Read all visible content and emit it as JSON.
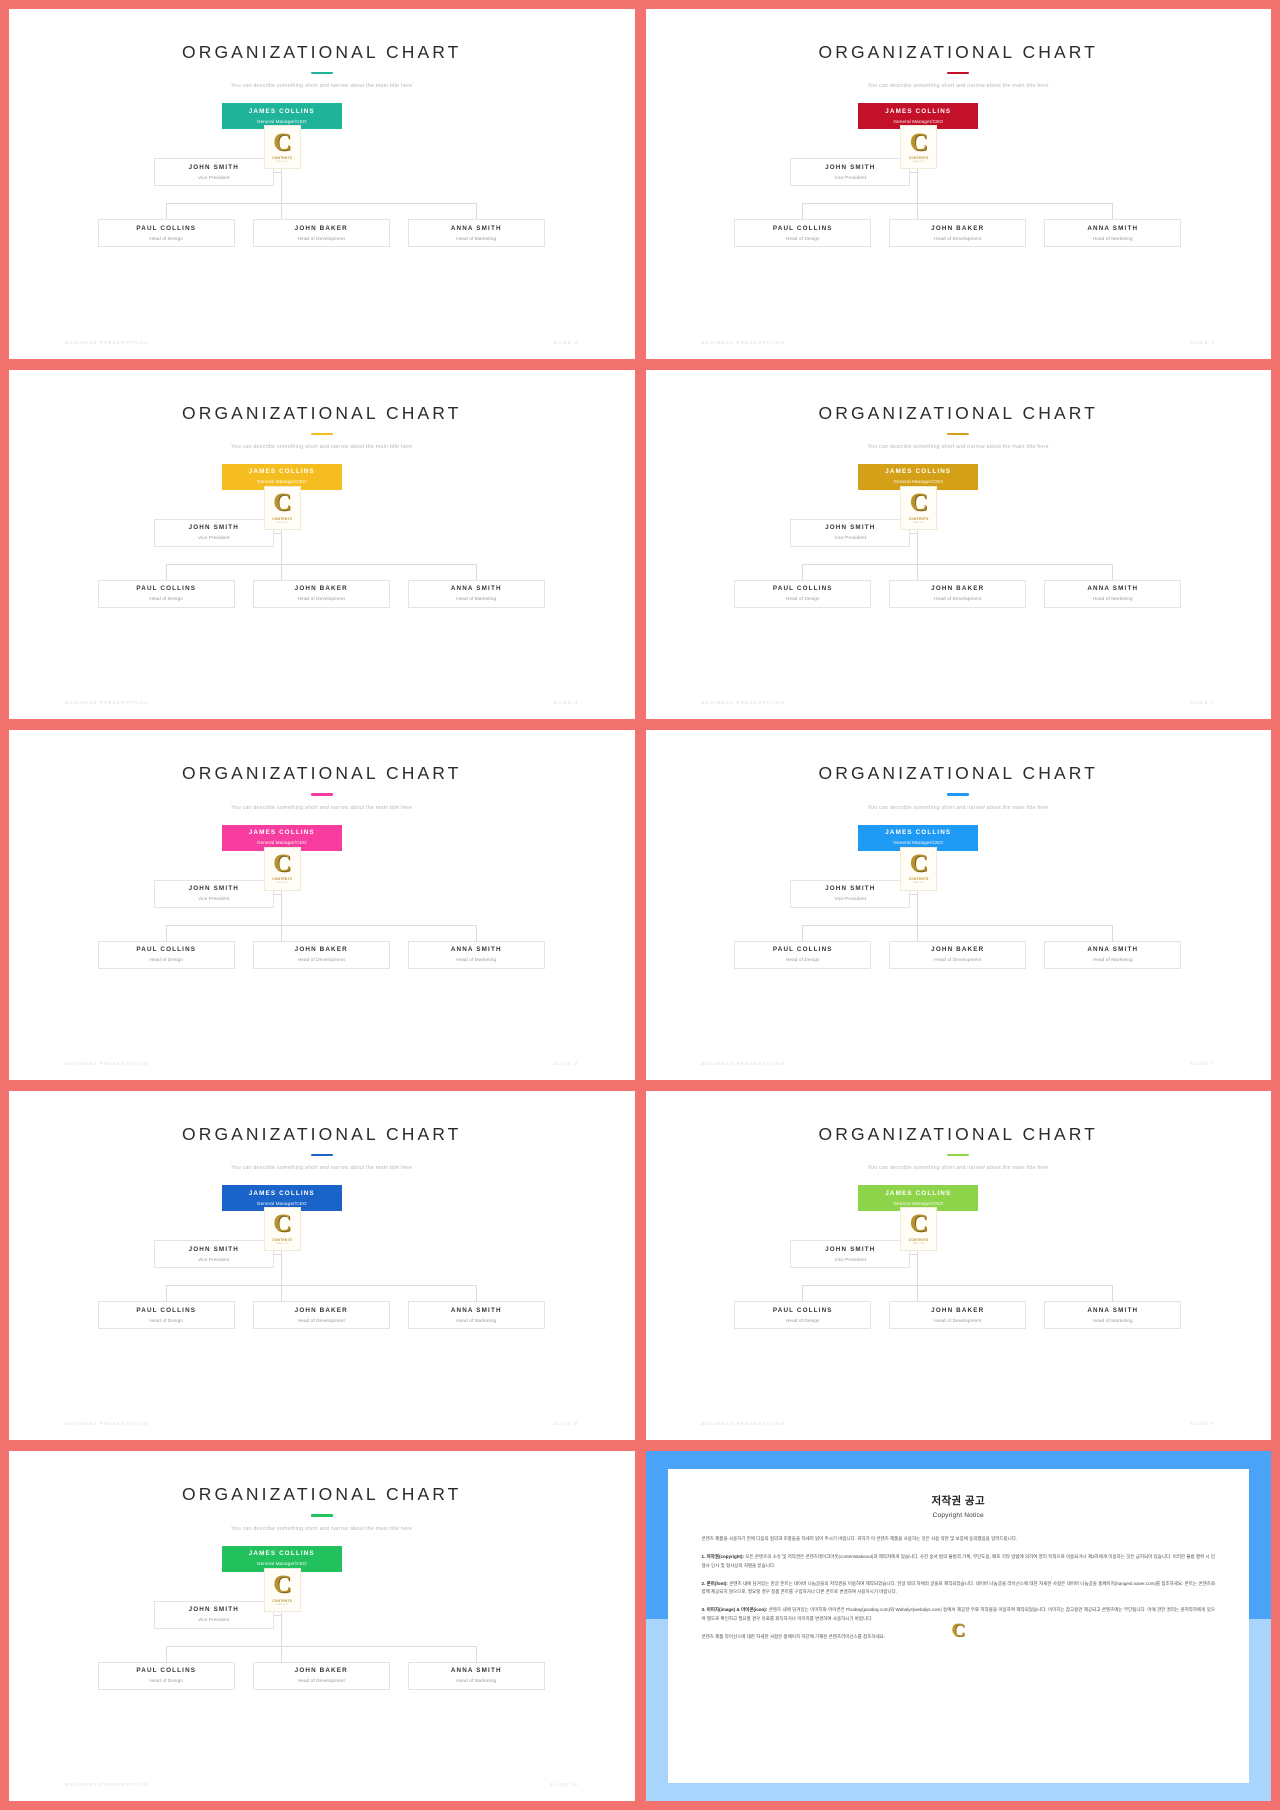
{
  "deck": {
    "title": "ORGANIZATIONAL CHART",
    "subtitle": "You can describe something short and narrow about the main title here",
    "footer_left": "BUSINESS PRESENTATION",
    "watermark": {
      "letter": "C",
      "line1": "CONTENTS",
      "line2": "TAKE OUT"
    },
    "frame_color": "#f2726f"
  },
  "org": {
    "ceo": {
      "name": "JAMES COLLINS",
      "role": "General Manager/CEO"
    },
    "vp": {
      "name": "JOHN SMITH",
      "role": "Vice President"
    },
    "level3": [
      {
        "name": "PAUL COLLINS",
        "role": "Head of Design"
      },
      {
        "name": "JOHN BAKER",
        "role": "Head of Development"
      },
      {
        "name": "ANNA SMITH",
        "role": "Head of Marketing"
      }
    ]
  },
  "slides": [
    {
      "accent": "#1fb39a",
      "ceo_bg": "#1fb39a",
      "slide_label": "SLIDE 2"
    },
    {
      "accent": "#c4112a",
      "ceo_bg": "#c4112a",
      "slide_label": "SLIDE 3"
    },
    {
      "accent": "#f5bd1f",
      "ceo_bg": "#f5bd1f",
      "slide_label": "SLIDE 4"
    },
    {
      "accent": "#d4a017",
      "ceo_bg": "#d4a017",
      "slide_label": "SLIDE 5"
    },
    {
      "accent": "#f73ea0",
      "ceo_bg": "#f73ea0",
      "slide_label": "SLIDE 6"
    },
    {
      "accent": "#1f9bf5",
      "ceo_bg": "#1f9bf5",
      "slide_label": "SLIDE 7"
    },
    {
      "accent": "#1a63c9",
      "ceo_bg": "#1a63c9",
      "slide_label": "SLIDE 8"
    },
    {
      "accent": "#8ed44a",
      "ceo_bg": "#8ed44a",
      "slide_label": "SLIDE 9"
    },
    {
      "accent": "#23c15e",
      "ceo_bg": "#23c15e",
      "slide_label": "SLIDE 10"
    }
  ],
  "copyright": {
    "title_ko": "저작권 공고",
    "title_en": "Copyright Notice",
    "intro": "콘텐츠 제품을 사용하기 전에 다음의 협약과 조항들을 자세히 읽어 주시기 바랍니다. 귀하가 이 콘텐츠 제품을 사용하는 것은 사용 약관 및 보증에 동의했음을 알려드립니다.",
    "p1_label": "1. 저작권(copyright):",
    "p1": "모든 콘텐츠의 소유 및 저작권은 콘텐츠테이크아웃(contentstakeout)과 제작자에게 있습니다. 사진 송서 법의 불법적 기록, 무단도용, 배포 기타 방법에 의하여 영리 목적으로 이용되거나 제3자에게 이용하는 것은 금지되어 있습니다. 이러한 불법 행위 시 민형사 인사 및 형사상의 처벌을 받습니다.",
    "p2_label": "2. 폰트(font):",
    "p2": "콘텐츠 내에 담겨있는 한글 폰트는 네이버 나눔글꼴의 저작권을 이용하여 제작되었습니다. 한글 외의 자체의 글꼴로 제작되었습니다. 네이버 나눔글꼴 라이선스에 대한 자세한 사항은 네이버 나눔글꼴 홈페이지(hangeul.naver.com)를 참조하세요. 폰트는 콘텐츠와 함께 제공되지 않으므로, 필요할 경우 정품 폰트를 구입하거나 다른 폰트로 변경하여 사용하시기 바랍니다.",
    "p3_label": "3. 이미지(image) & 아이콘(icon):",
    "p3": "콘텐츠 내에 담겨있는 이미지와 아이콘은 Pixabay(pixabay.com)와 Webalys(webalys.com) 등에서 제공한 무료 저작물을 이용하여 제작되었습니다. 이미지는 참고용만 제공되고 콘텐츠에는 무단됩니다. 이에 관한 권리는 원저작자에게 있으며 별도로 확인하고 필요할 경우 유료를 회득하거나 이미지를 변경하여 사용하시기 바랍니다.",
    "outro": "콘텐츠 제품 라이선스에 대한 자세한 사항은 홈페이지 하단에 기재된 콘텐츠라이선스를 참조하세요."
  }
}
